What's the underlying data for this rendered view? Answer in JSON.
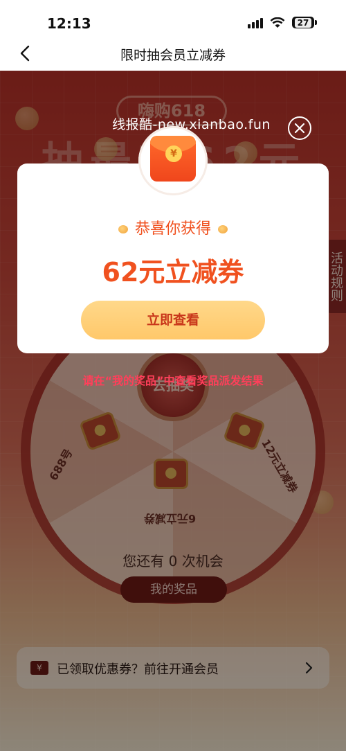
{
  "status_bar": {
    "time": "12:13",
    "battery": "27"
  },
  "nav": {
    "title": "限时抽会员立减券"
  },
  "background": {
    "banner_chip": "嗨购618",
    "banner_title": "抽最高62元",
    "rules_tab": "活动规则",
    "wheel_center": "去抽奖",
    "prizes": [
      "12元立减券",
      "6元立减券",
      "688号"
    ],
    "chance_text_prefix": "您还有",
    "chance_count": "0",
    "chance_text_suffix": "次机会",
    "my_prizes_button": "我的奖品",
    "bottom_banner_icon": "¥",
    "bottom_banner_text": "已领取优惠券？前往开通会员"
  },
  "modal": {
    "watermark": "线报酷-new.xianbao.fun",
    "envelope_symbol": "¥",
    "congrats": "恭喜你获得",
    "prize": "62元立减券",
    "view_button": "立即查看",
    "notice": "请在“我的奖品”中查看奖品派发结果"
  },
  "colors": {
    "accent": "#f0511f",
    "button": "#ffd07a",
    "notice": "#ff3f5a"
  },
  "icons": [
    "back-icon",
    "close-icon",
    "envelope-icon",
    "chevron-right-icon",
    "signal-icon",
    "wifi-icon",
    "battery-icon"
  ]
}
